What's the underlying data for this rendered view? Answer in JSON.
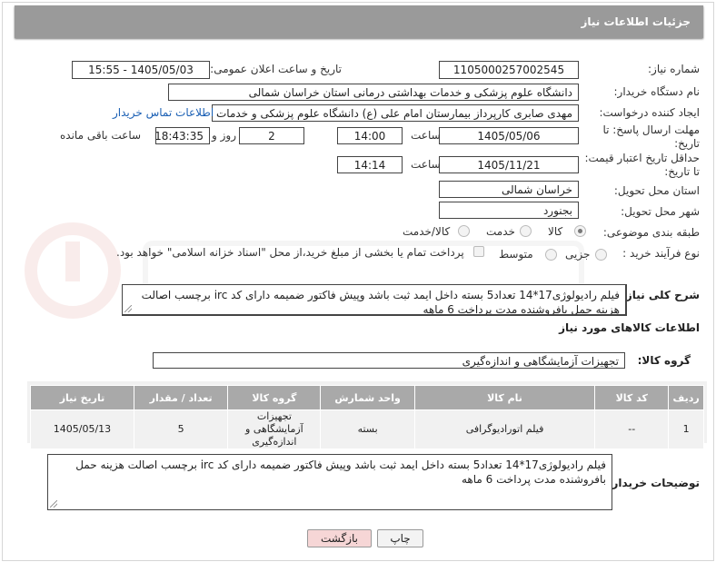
{
  "header": {
    "title": "جزئیات اطلاعات نیاز"
  },
  "form": {
    "need_number": {
      "label": "شماره نیاز:",
      "value": "1105000257002545"
    },
    "announce_datetime": {
      "label": "تاریخ و ساعت اعلان عمومی:",
      "value": "1405/05/03 - 15:55"
    },
    "buyer_org": {
      "label": "نام دستگاه خریدار:",
      "value": "دانشگاه علوم پزشکی و خدمات بهداشتی درمانی استان خراسان شمالی"
    },
    "requester": {
      "label": "ایجاد کننده درخواست:",
      "value": "مهدی صابری کارپرداز بیمارستان امام علی (ع) دانشگاه علوم پزشکی و خدمات بهداشتی",
      "contact_link": "اطلاعات تماس خریدار"
    },
    "deadline": {
      "label_line1": "مهلت ارسال پاسخ: تا",
      "label_line2": "تاریخ:",
      "date": "1405/05/06",
      "time_label": "ساعت",
      "time": "14:00",
      "days": "2",
      "days_label": "روز و",
      "remaining": "18:43:35",
      "remaining_label": "ساعت باقی مانده"
    },
    "price_validity": {
      "label_line1": "حداقل تاریخ اعتبار قیمت:",
      "label_line2": "تا تاریخ:",
      "date": "1405/11/21",
      "time_label": "ساعت",
      "time": "14:14"
    },
    "delivery_province": {
      "label": "استان محل تحویل:",
      "value": "خراسان شمالی"
    },
    "delivery_city": {
      "label": "شهر محل تحویل:",
      "value": "بجنورد"
    },
    "category": {
      "label": "طبقه بندی موضوعی:",
      "options": [
        {
          "label": "کالا",
          "selected": true
        },
        {
          "label": "خدمت",
          "selected": false
        },
        {
          "label": "کالا/خدمت",
          "selected": false
        }
      ]
    },
    "process_type": {
      "label": "نوع فرآیند خرید :",
      "options": [
        {
          "label": "جزیی",
          "selected": false
        },
        {
          "label": "متوسط",
          "selected": false
        }
      ],
      "payment_note": "پرداخت تمام یا بخشی از مبلغ خرید،از محل \"اسناد خزانه اسلامی\" خواهد بود."
    }
  },
  "description": {
    "label": "شرح کلی نیاز:",
    "text": "فیلم رادیولوژی17*14 تعداد5 بسته داخل ایمد ثبت باشد وپیش فاکتور ضمیمه دارای کد irc برچسب اصالت هزینه حمل بافروشنده مدت پرداخت 6 ماهه"
  },
  "goods_info": {
    "title": "اطلاعات کالاهای مورد نیاز"
  },
  "goods_group": {
    "label": "گروه کالا:",
    "value": "تجهیزات آزمایشگاهی و اندازه‌گیری"
  },
  "items_table": {
    "headers": [
      "ردیف",
      "کد کالا",
      "نام کالا",
      "واحد شمارش",
      "گروه کالا",
      "تعداد / مقدار",
      "تاریخ نیاز"
    ],
    "rows": [
      {
        "row": "1",
        "code": "--",
        "name": "فیلم اتورادیوگرافی",
        "unit": "بسته",
        "group": "تجهیزات آزمایشگاهی و اندازه‌گیری",
        "qty": "5",
        "date": "1405/05/13"
      }
    ]
  },
  "buyer_notes": {
    "label": "توضیحات خریدار:",
    "text": "فیلم رادیولوژی17*14 تعداد5 بسته داخل ایمد ثبت باشد وپیش فاکتور ضمیمه دارای کد irc برچسب اصالت هزینه حمل بافروشنده مدت پرداخت 6 ماهه"
  },
  "buttons": {
    "print": "چاپ",
    "back": "بازگشت"
  },
  "colors": {
    "header_bg": "#9a9a9a",
    "link": "#1a5fb4",
    "back_btn_bg": "#f6d6d6",
    "table_header": "#a9a9a9"
  }
}
